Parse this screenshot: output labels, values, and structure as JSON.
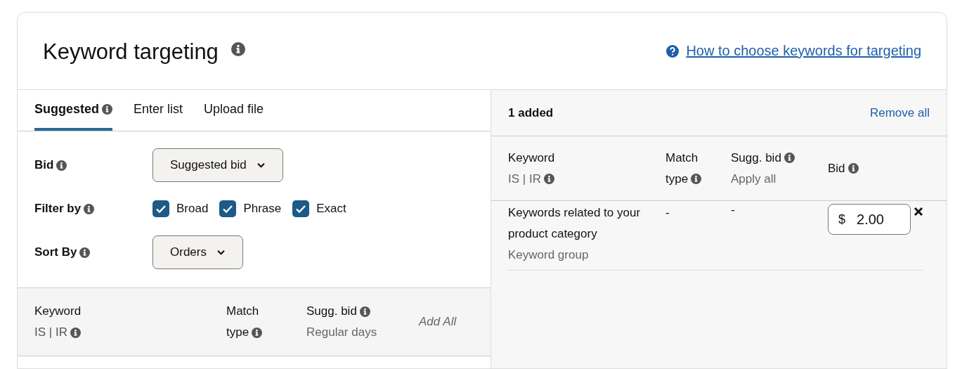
{
  "header": {
    "title": "Keyword targeting",
    "help_link": "How to choose keywords for targeting"
  },
  "tabs": [
    {
      "label": "Suggested",
      "info": true,
      "selected": true
    },
    {
      "label": "Enter list",
      "info": false,
      "selected": false
    },
    {
      "label": "Upload file",
      "info": false,
      "selected": false
    }
  ],
  "filters": [
    {
      "kind": "dropdown",
      "label": "Bid",
      "value": "Suggested bid"
    },
    {
      "kind": "checkboxes",
      "label": "Filter by",
      "options": [
        {
          "label": "Broad",
          "checked": true
        },
        {
          "label": "Phrase",
          "checked": true
        },
        {
          "label": "Exact",
          "checked": true
        }
      ]
    },
    {
      "kind": "dropdown",
      "label": "Sort By",
      "value": "Orders"
    }
  ],
  "suggested_table": {
    "columns": [
      {
        "title": "Keyword",
        "subtitle": "IS | IR",
        "title_info": false,
        "subtitle_info": true,
        "muted": true
      },
      {
        "title": "Match",
        "subtitle": "type",
        "title_info": false,
        "subtitle_info": true,
        "muted": false
      },
      {
        "title": "Sugg. bid",
        "subtitle": "Regular days",
        "title_info": true,
        "subtitle_info": false,
        "muted": true
      }
    ],
    "add_all": "Add All"
  },
  "added": {
    "count_label": "1 added",
    "remove_all": "Remove all",
    "columns": [
      {
        "title": "Keyword",
        "subtitle": "IS | IR",
        "title_info": false,
        "subtitle_info": true,
        "muted": true
      },
      {
        "title": "Match",
        "subtitle": "type",
        "title_info": false,
        "subtitle_info": true,
        "muted": false
      },
      {
        "title": "Sugg. bid",
        "subtitle": "Apply all",
        "title_info": true,
        "subtitle_info": false,
        "muted": true
      },
      {
        "title": "Bid",
        "title_info": true
      }
    ],
    "rows": [
      {
        "keyword": "Keywords related to your product category",
        "type_label": "Keyword group",
        "match_type": "-",
        "sugg_bid": "-",
        "currency": "$",
        "bid": "2.00"
      }
    ]
  }
}
